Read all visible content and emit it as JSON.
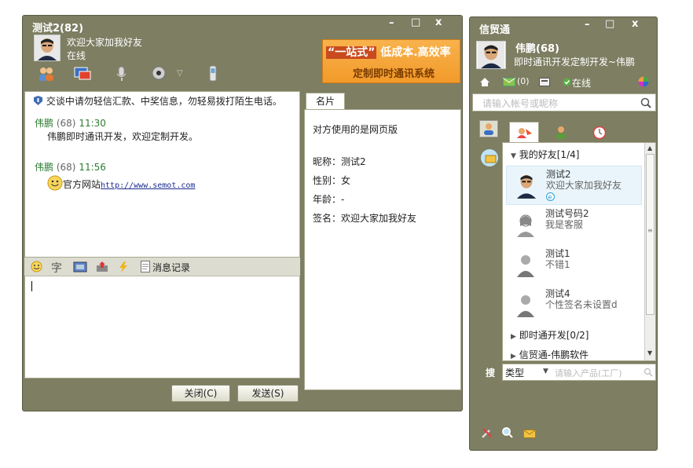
{
  "chat_window": {
    "title": "测试2(82)",
    "contact_signature": "欢迎大家加我好友",
    "contact_status": "在线",
    "banner": {
      "line1_highlight": "“一站式”",
      "line1_rest": "低成本.高效率",
      "line2": "定制即时通讯系统"
    },
    "security_notice": "交谈中请勿轻信汇款、中奖信息，勿轻易拨打陌生电话。",
    "messages": [
      {
        "sender": "伟鹏",
        "num": "(68)",
        "time": "11:30",
        "text": "伟鹏即时通讯开发，欢迎定制开发。"
      },
      {
        "sender": "伟鹏",
        "num": "(68)",
        "time": "11:56",
        "text": "官方网站",
        "link": "http://www.semot.com"
      }
    ],
    "input_toolbar": {
      "history_label": "消息记录"
    },
    "buttons": {
      "close": "关闭(C)",
      "send": "发送(S)"
    },
    "profile_tab": "名片",
    "profile": {
      "web_note": "对方使用的是网页版",
      "nickname_label": "昵称：",
      "nickname": "测试2",
      "gender_label": "性别：",
      "gender": "女",
      "age_label": "年龄：",
      "age": "-",
      "signature_label": "签名：",
      "signature": "欢迎大家加我好友"
    }
  },
  "im_window": {
    "app_title": "信贸通",
    "user_name": "伟鹏(68)",
    "user_signature": "即时通讯开发定制开发~伟鹏",
    "mail_count": "(0)",
    "status": "在线",
    "search_placeholder": "请输入帐号或昵称",
    "groups": [
      {
        "label": "我的好友[1/4]",
        "expanded": true
      },
      {
        "label": "即时通开发[0/2]",
        "expanded": false
      },
      {
        "label": "信贸通-伟鹏软件",
        "expanded": false
      }
    ],
    "contacts": [
      {
        "name": "测试2",
        "signature": "欢迎大家加我好友",
        "selected": true
      },
      {
        "name": "测试号码2",
        "signature": "我是客服"
      },
      {
        "name": "测试1",
        "signature": "不错1"
      },
      {
        "name": "测试4",
        "signature": "个性签名未设置d"
      }
    ],
    "bottom_search": {
      "label": "搜",
      "type_select": "类型",
      "placeholder": "请输入产品(工厂)"
    }
  }
}
